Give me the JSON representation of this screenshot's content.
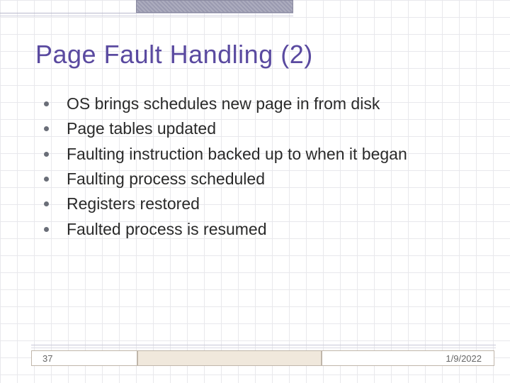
{
  "title": "Page Fault Handling (2)",
  "bullets": [
    "OS brings schedules new page in from disk",
    "Page tables updated",
    "Faulting instruction backed up to when it began",
    "Faulting process scheduled",
    "Registers restored",
    "Faulted process is resumed"
  ],
  "footer": {
    "page": "37",
    "date": "1/9/2022"
  }
}
